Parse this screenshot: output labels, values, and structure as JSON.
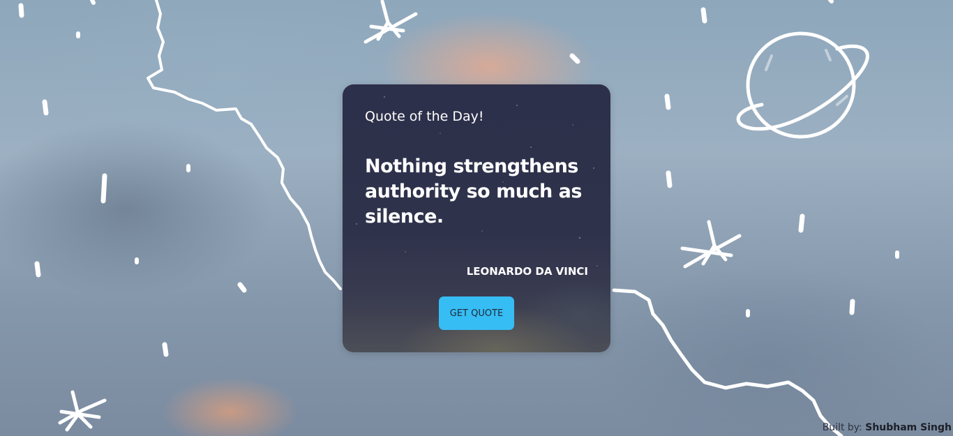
{
  "card": {
    "label": "Quote of the Day!",
    "quote": "Nothing strengthens authority so much as silence.",
    "author": "LEONARDO DA VINCI",
    "button_label": "GET QUOTE"
  },
  "footer": {
    "prefix": "Built by:",
    "name": "Shubham Singh"
  },
  "colors": {
    "button": "#36bdf3",
    "card": "#2d304a",
    "sky": "#8ea7bb"
  }
}
